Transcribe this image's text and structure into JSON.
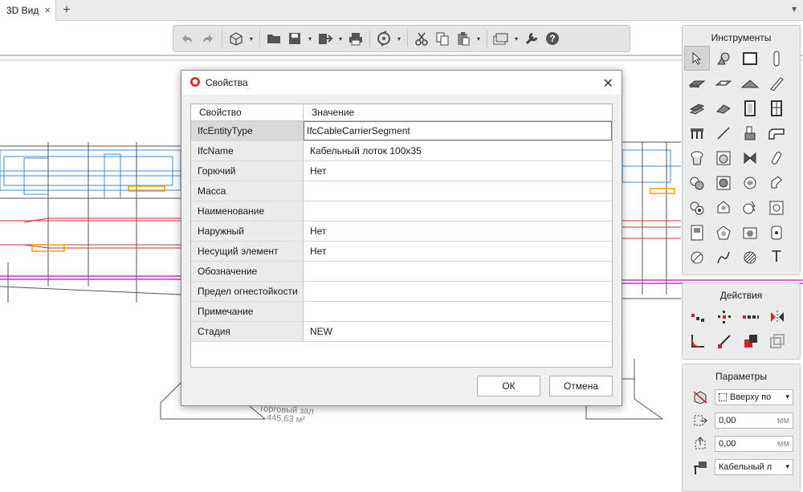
{
  "tabs": {
    "active_label": "3D Вид",
    "close": "×",
    "add": "+",
    "menu": "▾"
  },
  "toolbar": {
    "icons": [
      "undo-icon",
      "redo-icon",
      "3d-box-icon",
      "folder-open-icon",
      "save-icon",
      "export-icon",
      "print-icon",
      "sync-icon",
      "cut-icon",
      "copy-icon",
      "paste-icon",
      "layers-icon",
      "wrench-icon",
      "help-icon"
    ],
    "dropdown_arrow": "▾",
    "help_glyph": "?"
  },
  "panels": {
    "tools": {
      "title": "Инструменты",
      "text_tool_glyph": "T"
    },
    "actions": {
      "title": "Действия"
    },
    "params": {
      "title": "Параметры",
      "placement": "Вверху по",
      "offset_x": "0,00",
      "offset_y": "0,00",
      "unit": "мм",
      "type_value": "Кабельный л",
      "arrow": "▾"
    }
  },
  "viewport": {
    "room_name": "Торговый зал",
    "room_area": "445,63 м²",
    "accent_colors": {
      "duct": "#3a8fd6",
      "pipe_red": "#d32f2f",
      "cable_tray": "#cc33cc",
      "fitting": "#f0a000"
    }
  },
  "dialog": {
    "title": "Свойства",
    "close": "✕",
    "columns": {
      "property": "Свойство",
      "value": "Значение"
    },
    "rows": [
      {
        "property": "IfcEntityType",
        "value": "IfcCableCarrierSegment"
      },
      {
        "property": "IfcName",
        "value": "Кабельный лоток 100x35"
      },
      {
        "property": "Горючий",
        "value": "Нет"
      },
      {
        "property": "Масса",
        "value": ""
      },
      {
        "property": "Наименование",
        "value": ""
      },
      {
        "property": "Наружный",
        "value": "Нет"
      },
      {
        "property": "Несущий элемент",
        "value": "Нет"
      },
      {
        "property": "Обозначение",
        "value": ""
      },
      {
        "property": "Предел огнестойкости",
        "value": ""
      },
      {
        "property": "Примечание",
        "value": ""
      },
      {
        "property": "Стадия",
        "value": "NEW"
      }
    ],
    "ok_label": "ОК",
    "cancel_label": "Отмена"
  }
}
